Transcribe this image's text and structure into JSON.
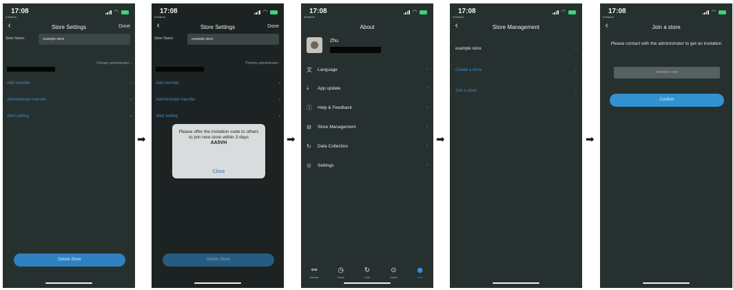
{
  "status": {
    "time": "17:08",
    "back_app": "◂ Search"
  },
  "arrows": [
    "➡",
    "➡",
    "➡",
    "➡"
  ],
  "screen1": {
    "title": "Store Settings",
    "done": "Done",
    "store_name_label": "Store Name:",
    "store_name_value": "example store",
    "owner_role": "Primary administrator",
    "rows": [
      "Add member",
      "Administrator transfer",
      "Alert setting"
    ],
    "delete_label": "Delete Store"
  },
  "screen2": {
    "title": "Store Settings",
    "done": "Done",
    "store_name_label": "Store Name:",
    "store_name_value": "example store",
    "owner_role": "Primary administrator",
    "rows": [
      "Add member",
      "Administrator transfer",
      "Alert setting"
    ],
    "delete_label": "Delete Store",
    "modal": {
      "message": "Please offer the invitation code to others to join new store within 3 days",
      "code": "AA5VH",
      "close": "Close"
    }
  },
  "screen3": {
    "title": "About",
    "user_name": "Zhu",
    "menu": [
      {
        "label": "Language",
        "icon": "language-icon"
      },
      {
        "label": "App update",
        "icon": "download-icon"
      },
      {
        "label": "Help & Feedback",
        "icon": "info-icon"
      },
      {
        "label": "Store Management",
        "icon": "store-icon"
      },
      {
        "label": "Data Collection",
        "icon": "refresh-icon"
      },
      {
        "label": "Settings",
        "icon": "gear-icon"
      }
    ],
    "tabs": [
      "Devices",
      "Timers",
      "Data",
      "Detect",
      "More"
    ],
    "active_tab": "More"
  },
  "screen4": {
    "title": "Store Management",
    "rows": [
      "example store",
      "Create a store",
      "Join a store"
    ]
  },
  "screen5": {
    "title": "Join a store",
    "message": "Please contact with the administrator to get an invitation",
    "code_placeholder": "Invitation code",
    "confirm": "Confirm"
  },
  "colors": {
    "background": "#26302f",
    "accent": "#2e82c2",
    "link": "#3f8fc9",
    "battery": "#3ad37a"
  }
}
